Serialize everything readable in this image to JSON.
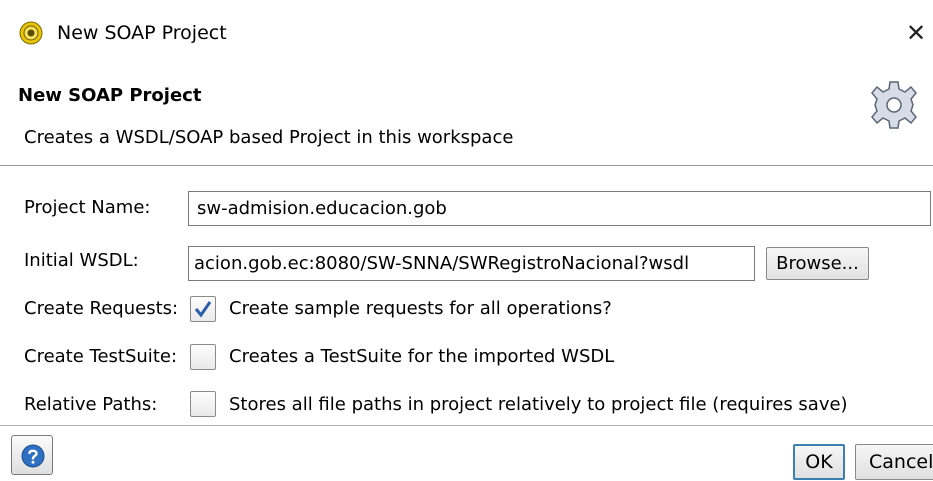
{
  "window": {
    "title": "New SOAP Project",
    "close_glyph": "✕",
    "app_icon": "soapui-icon"
  },
  "banner": {
    "title": "New SOAP Project",
    "description": "Creates a WSDL/SOAP based Project in this workspace",
    "icon": "gear-icon"
  },
  "form": {
    "project_name": {
      "label": "Project Name:",
      "value": "sw-admision.educacion.gob"
    },
    "initial_wsdl": {
      "label": "Initial WSDL:",
      "value": "acion.gob.ec:8080/SW-SNNA/SWRegistroNacional?wsdl",
      "browse_label": "Browse..."
    },
    "create_requests": {
      "label": "Create Requests:",
      "text": "Create sample requests for all operations?",
      "checked": true
    },
    "create_testsuite": {
      "label": "Create TestSuite:",
      "text": "Creates a TestSuite for the imported WSDL",
      "checked": false
    },
    "relative_paths": {
      "label": "Relative Paths:",
      "text": "Stores all file paths in project relatively to project file (requires save)",
      "checked": false
    }
  },
  "footer": {
    "help_icon": "help-icon",
    "ok_label": "OK",
    "cancel_label": "Cancel"
  },
  "colors": {
    "checkmark": "#2b5ea8",
    "focus_border": "#3c7fb1",
    "help_blue": "#2f6fc4"
  }
}
